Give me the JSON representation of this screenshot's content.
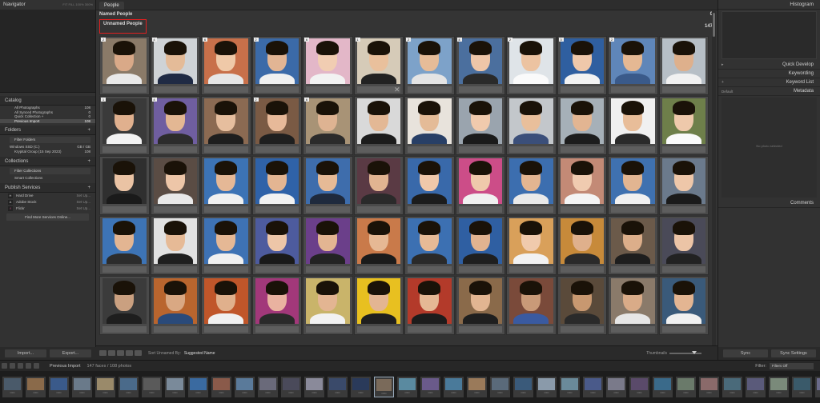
{
  "left": {
    "navigator_title": "Navigator",
    "nav_modes": "FIT  FILL  100%  300%",
    "catalog_title": "Catalog",
    "catalog_items": [
      {
        "label": "All Photographs",
        "count": "108"
      },
      {
        "label": "All Synced Photographs",
        "count": "0"
      },
      {
        "label": "Quick Collection +",
        "count": "0"
      },
      {
        "label": "Previous Import",
        "count": "108"
      }
    ],
    "folders_title": "Folders",
    "filter_folders": "Filter Folders",
    "volume": {
      "label": "Windows SSD (C:)",
      "info": "GB / GB"
    },
    "folder": {
      "label": "Krypital Group (15 Sep 2023)",
      "count": "108"
    },
    "collections_title": "Collections",
    "filter_collections": "Filter Collections",
    "smart_collections": "Smart Collections",
    "publish_title": "Publish Services",
    "services": [
      {
        "icon": "H",
        "label": "Hard Drive",
        "action": "Set Up..."
      },
      {
        "icon": "A",
        "label": "Adobe Stock",
        "action": "Set Up..."
      },
      {
        "icon": "f",
        "label": "Flickr",
        "action": "Set Up..."
      }
    ],
    "find_more": "Find More Services Online...",
    "import_label": "Import...",
    "export_label": "Export..."
  },
  "center": {
    "tab": "People",
    "named_label": "Named People",
    "named_count": "0",
    "unnamed_label": "Unnamed People",
    "unnamed_count": "147",
    "toolbar": {
      "sort_label": "Sort Unnamed By:",
      "sort_value": "Suggested Name",
      "thumbnails_label": "Thumbnails"
    }
  },
  "right": {
    "histogram_title": "Histogram",
    "quick_develop": "Quick Develop",
    "keywording": "Keywording",
    "keyword_list": "Keyword List",
    "metadata": "Metadata",
    "metadata_preset": "Default",
    "no_photo": "No photo selected",
    "comments": "Comments",
    "sync_label": "Sync",
    "sync_settings_label": "Sync Settings"
  },
  "filmstrip_bar": {
    "path": "Previous Import",
    "count": "147 faces / 108 photos",
    "filter_label": "Filter:",
    "filter_value": "Filters Off"
  },
  "face_rows": [
    [
      {
        "badge": "2",
        "bg": "#8a7a68",
        "skin": "#d9a988",
        "shirt": "#e9e9e9"
      },
      {
        "badge": "4",
        "bg": "#cfd3d6",
        "skin": "#e4bb98",
        "shirt": "#1f2a44"
      },
      {
        "badge": "6",
        "bg": "#c8704a",
        "skin": "#efc9a8",
        "shirt": "#e6e6e6"
      },
      {
        "badge": "2",
        "bg": "#3b6aa8",
        "skin": "#e2b594",
        "shirt": "#f0f0f0"
      },
      {
        "badge": "6",
        "bg": "#e3b7c8",
        "skin": "#f1cdb2",
        "shirt": "#f2f2f2"
      },
      {
        "badge": "1",
        "bg": "#d6cbb8",
        "skin": "#e9c09c",
        "shirt": "#222"
      },
      {
        "badge": "2",
        "bg": "#7da2c9",
        "skin": "#e6bc98",
        "shirt": "#e4e4e4"
      },
      {
        "badge": "4",
        "bg": "#4b6f9e",
        "skin": "#eec6a8",
        "shirt": "#2a2a2a"
      },
      {
        "badge": "2",
        "bg": "#dfe4e8",
        "skin": "#ecc3a1",
        "shirt": "#fafafa"
      },
      {
        "badge": "3",
        "bg": "#2f5fa0",
        "skin": "#efc8aa",
        "shirt": "#f2f2f2"
      },
      {
        "badge": "2",
        "bg": "#5f86b9",
        "skin": "#e5b893",
        "shirt": "#3a5a8a"
      },
      {
        "badge": "",
        "bg": "#b7bfc6",
        "skin": "#deb08c",
        "shirt": "#f1f1f1"
      }
    ],
    [
      {
        "badge": "1",
        "bg": "#3a3a3a",
        "skin": "#e0b08e",
        "shirt": "#f2f2f2"
      },
      {
        "badge": "4",
        "bg": "#6f5ea0",
        "skin": "#e3b793",
        "shirt": "#2c2c2c"
      },
      {
        "badge": "",
        "bg": "#8b6a52",
        "skin": "#e6be9e",
        "shirt": "#1e1e1e"
      },
      {
        "badge": "2",
        "bg": "#7a5a44",
        "skin": "#e7b999",
        "shirt": "#1f1f1f"
      },
      {
        "badge": "6",
        "bg": "#a89376",
        "skin": "#deb392",
        "shirt": "#2b2b2b"
      },
      {
        "badge": "",
        "bg": "#d9d9d9",
        "skin": "#e3b895",
        "shirt": "#1c1c1c"
      },
      {
        "badge": "",
        "bg": "#e8e3dc",
        "skin": "#e4bb97",
        "shirt": "#283f66"
      },
      {
        "badge": "",
        "bg": "#9aa4ae",
        "skin": "#f0caad",
        "shirt": "#1b1b1b"
      },
      {
        "badge": "",
        "bg": "#c3c7cb",
        "skin": "#e9bf9b",
        "shirt": "#3b4f7a"
      },
      {
        "badge": "",
        "bg": "#a6b0b8",
        "skin": "#e2b592",
        "shirt": "#1d1d1d"
      },
      {
        "badge": "",
        "bg": "#f0f0f0",
        "skin": "#e8bd99",
        "shirt": "#2a2a2a"
      },
      {
        "badge": "",
        "bg": "#6e7f4a",
        "skin": "#eec9ab",
        "shirt": "#fafafa"
      }
    ],
    [
      {
        "badge": "",
        "bg": "#2f2f2f",
        "skin": "#eac3a4",
        "shirt": "#1a1a1a"
      },
      {
        "badge": "",
        "bg": "#5a4c44",
        "skin": "#edc6a8",
        "shirt": "#e8e8e8"
      },
      {
        "badge": "",
        "bg": "#3c73b5",
        "skin": "#e5b896",
        "shirt": "#f0f0f0"
      },
      {
        "badge": "",
        "bg": "#2f62a8",
        "skin": "#e3b592",
        "shirt": "#f2f2f2"
      },
      {
        "badge": "",
        "bg": "#3e6dac",
        "skin": "#e6ba96",
        "shirt": "#1f2a3d"
      },
      {
        "badge": "",
        "bg": "#5a3a44",
        "skin": "#e1b491",
        "shirt": "#2a2a2a"
      },
      {
        "badge": "",
        "bg": "#3969aa",
        "skin": "#efc8aa",
        "shirt": "#1c1c1c"
      },
      {
        "badge": "",
        "bg": "#cc4d88",
        "skin": "#efc9ab",
        "shirt": "#f0f0f0"
      },
      {
        "badge": "",
        "bg": "#3c6eaf",
        "skin": "#e3b591",
        "shirt": "#e9e9e9"
      },
      {
        "badge": "",
        "bg": "#c38a76",
        "skin": "#f0cbb0",
        "shirt": "#f4f4f4"
      },
      {
        "badge": "",
        "bg": "#3f71b0",
        "skin": "#e2b591",
        "shirt": "#f0f0f0"
      },
      {
        "badge": "",
        "bg": "#6b7a8c",
        "skin": "#eec7a9",
        "shirt": "#1b1b1b"
      }
    ],
    [
      {
        "badge": "",
        "bg": "#3d74b6",
        "skin": "#e3b592",
        "shirt": "#2c2c2c"
      },
      {
        "badge": "",
        "bg": "#e2e2e2",
        "skin": "#e6ba96",
        "shirt": "#1f1f1f"
      },
      {
        "badge": "",
        "bg": "#3e72b4",
        "skin": "#e5b895",
        "shirt": "#f0f0f0"
      },
      {
        "badge": "",
        "bg": "#4d5b9e",
        "skin": "#edc6a8",
        "shirt": "#1a1a1a"
      },
      {
        "badge": "",
        "bg": "#6b3f8a",
        "skin": "#e3b592",
        "shirt": "#232323"
      },
      {
        "badge": "",
        "bg": "#c97a4a",
        "skin": "#e6b894",
        "shirt": "#1b1b1b"
      },
      {
        "badge": "",
        "bg": "#3c70b2",
        "skin": "#e6ba96",
        "shirt": "#2a2a2a"
      },
      {
        "badge": "",
        "bg": "#2f5fa2",
        "skin": "#e1b390",
        "shirt": "#1f1f1f"
      },
      {
        "badge": "",
        "bg": "#d9a05a",
        "skin": "#f0caad",
        "shirt": "#f2f2f2"
      },
      {
        "badge": "",
        "bg": "#c78a3a",
        "skin": "#dfb08c",
        "shirt": "#2a2a2a"
      },
      {
        "badge": "",
        "bg": "#6b5a4a",
        "skin": "#dcae8a",
        "shirt": "#1e1e1e"
      },
      {
        "badge": "",
        "bg": "#4a4a58",
        "skin": "#ecc4a6",
        "shirt": "#222"
      }
    ],
    [
      {
        "badge": "",
        "bg": "#3b3b3b",
        "skin": "#caa080",
        "shirt": "#1e1e1e"
      },
      {
        "badge": "",
        "bg": "#b9652e",
        "skin": "#d9a883",
        "shirt": "#2a4a7a"
      },
      {
        "badge": "",
        "bg": "#c0562a",
        "skin": "#e0b08c",
        "shirt": "#f0f0f0"
      },
      {
        "badge": "",
        "bg": "#a2387a",
        "skin": "#e9b2a0",
        "shirt": "#2a2a2a"
      },
      {
        "badge": "",
        "bg": "#c9b46a",
        "skin": "#e3b592",
        "shirt": "#f2f2f2"
      },
      {
        "badge": "",
        "bg": "#e8c020",
        "skin": "#e3b592",
        "shirt": "#1f1f1f"
      },
      {
        "badge": "",
        "bg": "#b33a2a",
        "skin": "#e5b894",
        "shirt": "#1c1c1c"
      },
      {
        "badge": "",
        "bg": "#8a6a4a",
        "skin": "#e2b591",
        "shirt": "#1f1f1f"
      },
      {
        "badge": "",
        "bg": "#7a4a3a",
        "skin": "#c99a78",
        "shirt": "#3a5aa0"
      },
      {
        "badge": "",
        "bg": "#5a4a3a",
        "skin": "#c89870",
        "shirt": "#2a2a2a"
      },
      {
        "badge": "",
        "bg": "#8a7a6a",
        "skin": "#d9ab88",
        "shirt": "#e6e6e6"
      },
      {
        "badge": "",
        "bg": "#3a5a7a",
        "skin": "#e3b592",
        "shirt": "#f0f0f0"
      }
    ]
  ],
  "filmstrip_colors": [
    "#4a5a6a",
    "#8a6a4a",
    "#3a5a8a",
    "#6a7a8a",
    "#9a8a6a",
    "#4a6a8a",
    "#5a5a5a",
    "#7a8a9a",
    "#3a6aa0",
    "#8a5a4a",
    "#5a7a9a",
    "#6a6a7a",
    "#4a4a5a",
    "#8a8a9a",
    "#3a4a6a",
    "#2a3a5a",
    "#7a6a5a",
    "#5a8aa0",
    "#6a5a8a",
    "#4a7a9a",
    "#9a7a5a",
    "#5a6a7a",
    "#3a5a7a",
    "#8a9aaa",
    "#6a8a9a",
    "#4a5a8a",
    "#7a7a8a",
    "#5a4a6a",
    "#3a6a8a",
    "#6a7a6a",
    "#8a6a6a",
    "#4a6a7a",
    "#5a5a7a",
    "#7a8a7a",
    "#3a5a6a",
    "#6a6a8a"
  ]
}
